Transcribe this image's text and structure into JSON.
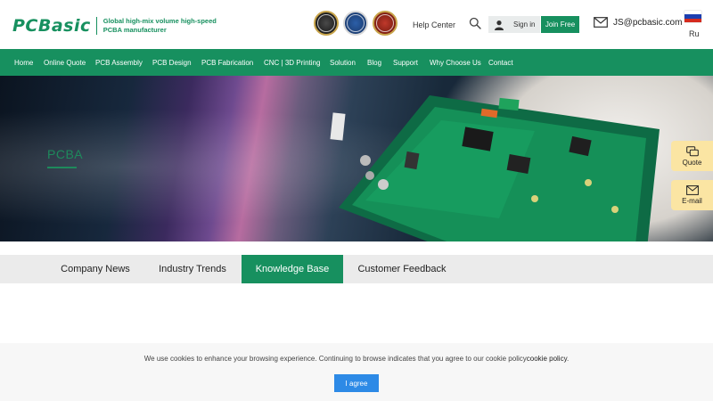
{
  "brand": {
    "logo_text": "PCBasic",
    "tagline_line1": "Global high-mix volume high-speed",
    "tagline_line2": "PCBA manufacturer",
    "primary_color": "#17905f"
  },
  "header": {
    "certifications": [
      "iso-certificate-icon",
      "iatf-certificate-icon",
      "iso-9001-certificate-icon"
    ],
    "help_center": "Help Center",
    "search_icon": "search-icon",
    "sign_in": "Sign in",
    "join_free": "Join Free",
    "email": "JS@pcbasic.com",
    "language": "Ru"
  },
  "nav": {
    "items": [
      "Home",
      "Online Quote",
      "PCB Assembly",
      "PCB Design",
      "PCB Fabrication",
      "CNC | 3D Printing",
      "Solution",
      "Blog",
      "Support",
      "Why Choose Us",
      "Contact"
    ]
  },
  "hero": {
    "title": "PCBA"
  },
  "float": {
    "quote": "Quote",
    "email": "E-mail",
    "background": "#fbe5a3"
  },
  "tabs": {
    "items": [
      "Company News",
      "Industry Trends",
      "Knowledge Base",
      "Customer Feedback"
    ],
    "active": "Knowledge Base"
  },
  "cookie": {
    "message": "We use cookies to enhance your browsing experience. Continuing to browse indicates that you agree to our cookie policy",
    "link": "cookie policy",
    "period": ".",
    "agree": "I agree",
    "button_color": "#2d8ae6"
  }
}
